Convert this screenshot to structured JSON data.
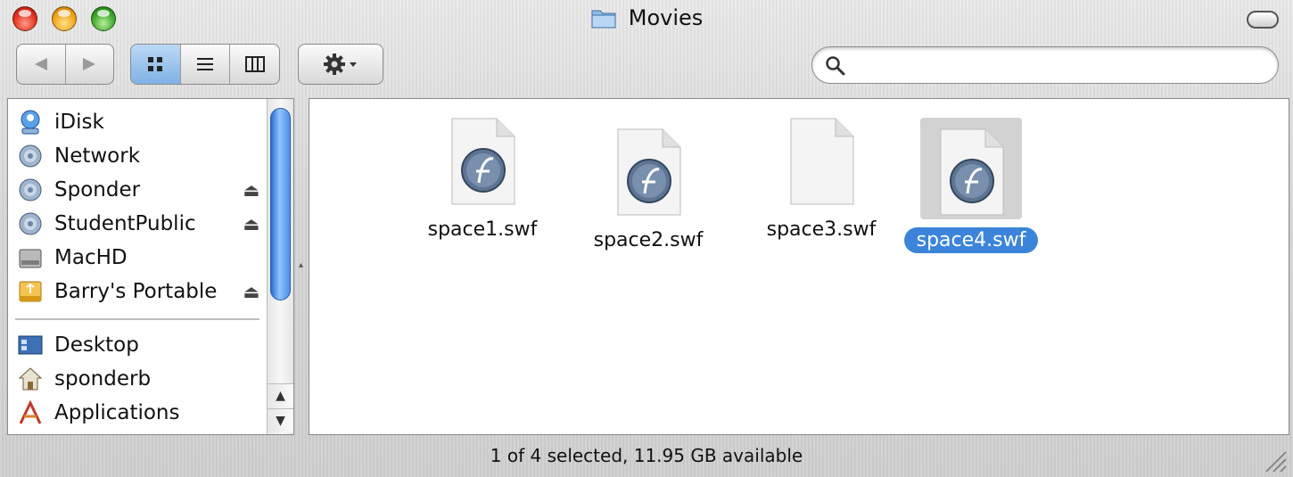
{
  "window": {
    "title": "Movies"
  },
  "search": {
    "placeholder": "",
    "value": ""
  },
  "sidebar": {
    "devices": [
      {
        "label": "iDisk",
        "icon": "idisk-icon",
        "eject": false
      },
      {
        "label": "Network",
        "icon": "network-icon",
        "eject": false
      },
      {
        "label": "Sponder",
        "icon": "server-icon",
        "eject": true
      },
      {
        "label": "StudentPublic",
        "icon": "server-icon",
        "eject": true
      },
      {
        "label": "MacHD",
        "icon": "hard-drive-icon",
        "eject": false
      },
      {
        "label": "Barry's Portable",
        "icon": "usb-drive-icon",
        "eject": true
      }
    ],
    "places": [
      {
        "label": "Desktop",
        "icon": "desktop-icon"
      },
      {
        "label": "sponderb",
        "icon": "home-icon"
      },
      {
        "label": "Applications",
        "icon": "applications-icon"
      }
    ],
    "eject_glyph": "⏏"
  },
  "files": [
    {
      "name": "space1.swf",
      "icon": "flash-document-icon",
      "selected": false
    },
    {
      "name": "space2.swf",
      "icon": "flash-document-icon",
      "selected": false
    },
    {
      "name": "space3.swf",
      "icon": "blank-document-icon",
      "selected": false
    },
    {
      "name": "space4.swf",
      "icon": "flash-document-icon",
      "selected": true
    }
  ],
  "status": {
    "text": "1 of 4 selected, 11.95 GB available"
  },
  "colors": {
    "selection": "#3b84d9",
    "active_view": "#7fb1e6"
  }
}
